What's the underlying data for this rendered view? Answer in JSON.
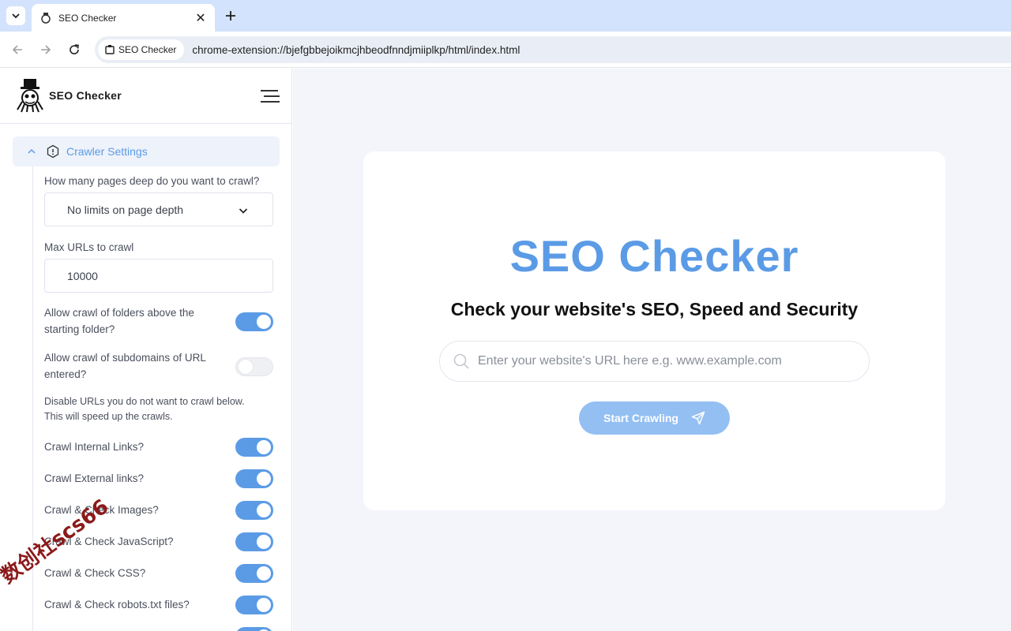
{
  "browser": {
    "tab_title": "SEO Checker",
    "chip_label": "SEO Checker",
    "url": "chrome-extension://bjefgbbejoikmcjhbeodfnndjmiiplkp/html/index.html"
  },
  "sidebar": {
    "brand": "SEO Checker",
    "section_label": "Crawler Settings",
    "depth_question": "How many pages deep do you want to crawl?",
    "depth_value": "No limits on page depth",
    "max_urls_label": "Max URLs to crawl",
    "max_urls_value": "10000",
    "folders_label": "Allow crawl of folders above the starting folder?",
    "folders_on": true,
    "subdomains_label": "Allow crawl of subdomains of URL entered?",
    "subdomains_on": false,
    "disable_note": "Disable URLs you do not want to crawl below. This will speed up the crawls.",
    "options": [
      {
        "label": "Crawl Internal Links?",
        "on": true
      },
      {
        "label": "Crawl External links?",
        "on": true
      },
      {
        "label": "Crawl & Check Images?",
        "on": true
      },
      {
        "label": "Crawl & Check JavaScript?",
        "on": true
      },
      {
        "label": "Crawl & Check CSS?",
        "on": true
      },
      {
        "label": "Crawl & Check robots.txt files?",
        "on": true
      }
    ]
  },
  "main": {
    "title": "SEO Checker",
    "subtitle": "Check your website's SEO, Speed and Security",
    "search_placeholder": "Enter your website's URL here e.g. www.example.com",
    "start_label": "Start Crawling"
  },
  "watermark": "数创社scs66",
  "colors": {
    "accent": "#5b9be6",
    "button": "#93bff3",
    "background": "#f3f5fb"
  }
}
